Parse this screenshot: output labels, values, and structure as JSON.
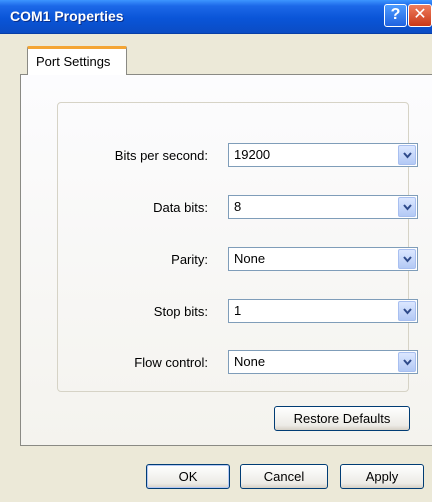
{
  "window": {
    "title": "COM1 Properties",
    "help_glyph": "?",
    "close_glyph": "✕"
  },
  "tabs": [
    {
      "label": "Port Settings",
      "active": true
    }
  ],
  "settings": [
    {
      "label": "Bits per second:",
      "value": "19200"
    },
    {
      "label": "Data bits:",
      "value": "8"
    },
    {
      "label": "Parity:",
      "value": "None"
    },
    {
      "label": "Stop bits:",
      "value": "1"
    },
    {
      "label": "Flow control:",
      "value": "None"
    }
  ],
  "buttons": {
    "restore": "Restore Defaults",
    "ok": "OK",
    "cancel": "Cancel",
    "apply": "Apply"
  },
  "colors": {
    "titlebar": "#0a55d8",
    "tab_highlight": "#f4a534",
    "dialog_face": "#ece9d8"
  },
  "icons": {
    "dropdown": "chevron-down-icon",
    "help": "help-icon",
    "close": "close-icon"
  }
}
